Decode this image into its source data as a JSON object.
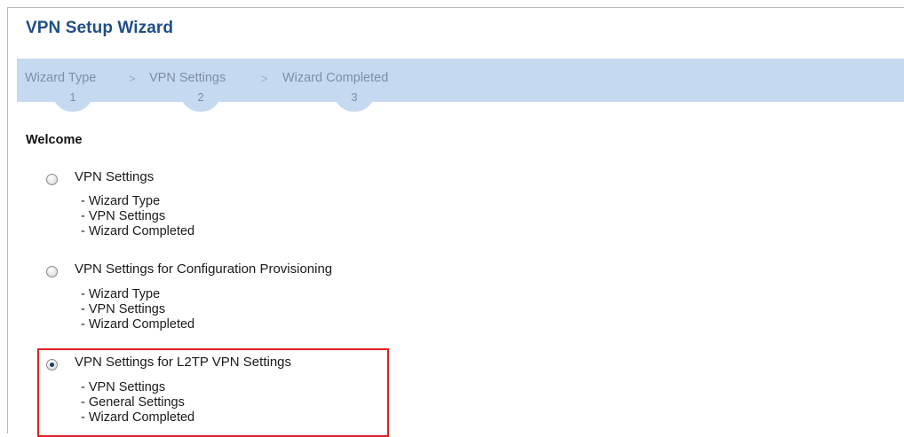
{
  "header": {
    "title": "VPN Setup Wizard"
  },
  "steps": [
    {
      "label": "Wizard Type",
      "number": "1"
    },
    {
      "label": "VPN Settings",
      "number": "2"
    },
    {
      "label": "Wizard Completed",
      "number": "3"
    }
  ],
  "step_separator": ">",
  "section": {
    "title": "Welcome"
  },
  "options": [
    {
      "label": "VPN Settings",
      "selected": false,
      "steps": [
        "- Wizard Type",
        "- VPN Settings",
        "- Wizard Completed"
      ]
    },
    {
      "label": "VPN Settings for Configuration Provisioning",
      "selected": false,
      "steps": [
        "- Wizard Type",
        "- VPN Settings",
        "- Wizard Completed"
      ]
    },
    {
      "label": "VPN Settings for L2TP VPN Settings",
      "selected": true,
      "steps": [
        "- VPN Settings",
        "- General Settings",
        "- Wizard Completed"
      ]
    }
  ],
  "colors": {
    "title": "#1f4e87",
    "steps_bar": "#c5daf0",
    "highlight": "#e02020"
  }
}
